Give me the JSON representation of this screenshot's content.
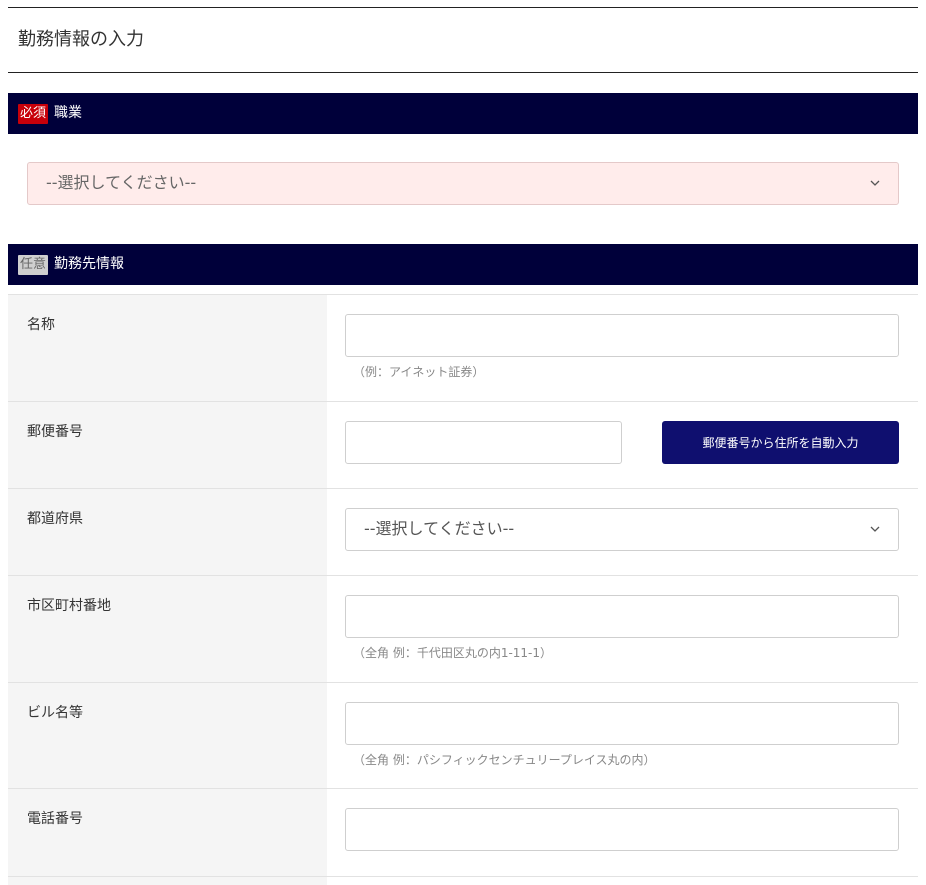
{
  "page": {
    "title": "勤務情報の入力"
  },
  "occupation": {
    "badge": "必須",
    "label": "職業",
    "select_value": "--選択してください--",
    "chevron_icon": "chevron-down-icon"
  },
  "employer": {
    "badge": "任意",
    "label": "勤務先情報",
    "rows": {
      "name": {
        "label": "名称",
        "value": "",
        "hint": "（例：アイネット証券）"
      },
      "postal": {
        "label": "郵便番号",
        "value": "",
        "button_label": "郵便番号から住所を自動入力"
      },
      "prefecture": {
        "label": "都道府県",
        "select_value": "--選択してください--"
      },
      "address": {
        "label": "市区町村番地",
        "value": "",
        "hint": "（全角 例：千代田区丸の内1-11-1）"
      },
      "building": {
        "label": "ビル名等",
        "value": "",
        "hint": "（全角 例：パシフィックセンチュリープレイス丸の内）"
      },
      "phone": {
        "label": "電話番号",
        "value": ""
      }
    }
  },
  "colors": {
    "header_bg": "#00003a",
    "required_badge": "#c8000a",
    "optional_badge": "#cfcfcf",
    "button_bg": "#0f0f6f",
    "error_select_bg": "#ffeceb"
  }
}
